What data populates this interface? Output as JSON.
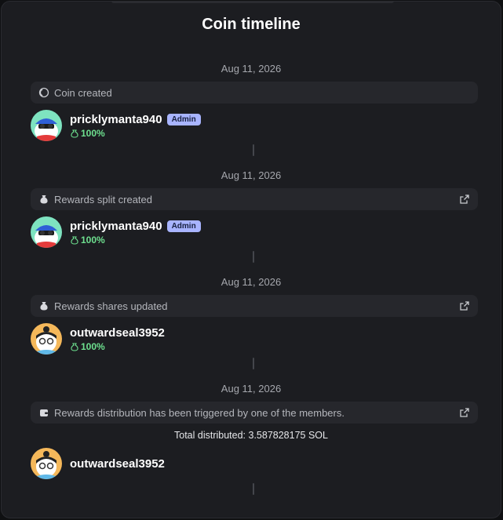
{
  "title": "Coin timeline",
  "colors": {
    "share_green": "#6ee08f",
    "admin_badge": "#a8b4ff",
    "panel_bg": "#1c1d21"
  },
  "timeline": [
    {
      "date": "Aug 11, 2026",
      "event": {
        "label": "Coin created",
        "icon": "coin-icon",
        "has_link": false
      },
      "member": {
        "name": "pricklymanta940",
        "badge": "Admin",
        "share": "100%",
        "avatar": "manta-avatar"
      }
    },
    {
      "date": "Aug 11, 2026",
      "event": {
        "label": "Rewards split created",
        "icon": "money-bag-icon",
        "has_link": true
      },
      "member": {
        "name": "pricklymanta940",
        "badge": "Admin",
        "share": "100%",
        "avatar": "manta-avatar"
      }
    },
    {
      "date": "Aug 11, 2026",
      "event": {
        "label": "Rewards shares updated",
        "icon": "money-bag-icon",
        "has_link": true
      },
      "member": {
        "name": "outwardseal3952",
        "share": "100%",
        "avatar": "seal-avatar"
      }
    },
    {
      "date": "Aug 11, 2026",
      "event": {
        "label": "Rewards distribution has been triggered by one of the members.",
        "icon": "wallet-icon",
        "has_link": true
      },
      "total": "Total distributed: 3.587828175 SOL",
      "member": {
        "name": "outwardseal3952",
        "avatar": "seal-avatar"
      }
    }
  ]
}
